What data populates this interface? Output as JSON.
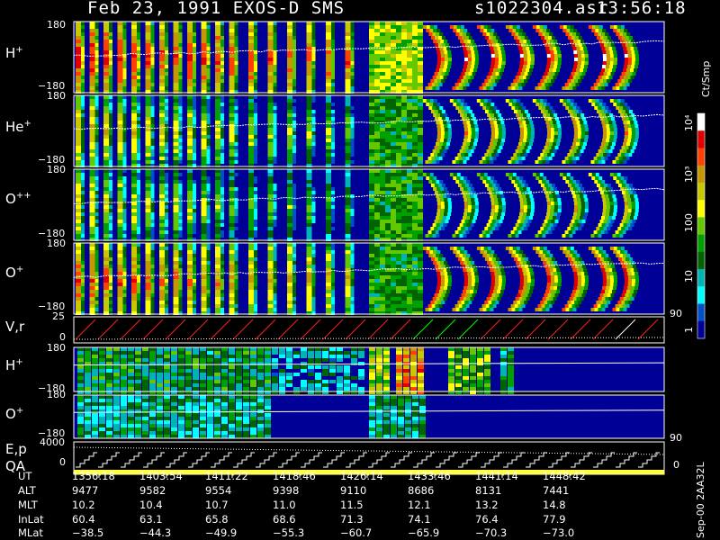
{
  "header": {
    "title": "Feb 23, 1991   EXOS-D SMS",
    "file": "s1022304.asr",
    "time": "13:56:18"
  },
  "panels": [
    {
      "label": "H+",
      "sup": "+",
      "base": "H",
      "top_tick": "180",
      "bottom_tick": "−180"
    },
    {
      "label": "He+",
      "sup": "+",
      "base": "He",
      "top_tick": "180",
      "bottom_tick": "−180"
    },
    {
      "label": "O++",
      "sup": "++",
      "base": "O",
      "top_tick": "180",
      "bottom_tick": "−180"
    },
    {
      "label": "O+",
      "sup": "+",
      "base": "O",
      "top_tick": "180",
      "bottom_tick": "−180"
    }
  ],
  "vr_panel": {
    "label": "V,r",
    "top_tick": "25",
    "bottom_tick": "0",
    "right_tick": "90"
  },
  "lower_panels": [
    {
      "label": "H+",
      "sup": "+",
      "base": "H",
      "top_tick": "180",
      "bottom_tick": "−180"
    },
    {
      "label": "O+",
      "sup": "+",
      "base": "O",
      "top_tick": "180",
      "bottom_tick": "−180",
      "right_tick": "90"
    }
  ],
  "ep_panel": {
    "label1": "E,p",
    "label2": "QA",
    "top_tick": "4000",
    "bottom_tick": "0",
    "right_tick": "0"
  },
  "colorbar": {
    "unit": "Ct/Smp",
    "ticks": [
      "10⁴",
      "10³",
      "100",
      "10",
      "1"
    ],
    "colors": [
      "#ffffff",
      "#e00000",
      "#ff4000",
      "#c89600",
      "#c8c800",
      "#ffff00",
      "#64c800",
      "#00a000",
      "#006400",
      "#00b4b4",
      "#00ffff",
      "#0050c8",
      "#000096"
    ]
  },
  "footer": {
    "rows": [
      {
        "label": "UT",
        "values": [
          "1356:18",
          "1403:54",
          "1411:22",
          "1418:46",
          "1426:14",
          "1433:46",
          "1441:14",
          "1448:42"
        ]
      },
      {
        "label": "ALT",
        "values": [
          "9477",
          "9582",
          "9554",
          "9398",
          "9110",
          "8686",
          "8131",
          "7441"
        ]
      },
      {
        "label": "MLT",
        "values": [
          "10.2",
          "10.4",
          "10.7",
          "11.0",
          "11.5",
          "12.1",
          "13.2",
          "14.8"
        ]
      },
      {
        "label": "InLat",
        "values": [
          "60.4",
          "63.1",
          "65.8",
          "68.6",
          "71.3",
          "74.1",
          "76.4",
          "77.9"
        ]
      },
      {
        "label": "MLat",
        "values": [
          "−38.5",
          "−44.3",
          "−49.9",
          "−55.3",
          "−60.7",
          "−65.9",
          "−70.3",
          "−73.0"
        ]
      }
    ],
    "side_label": "Sep-00  2AA32L"
  },
  "chart_data": {
    "type": "heatmap",
    "title": "Feb 23, 1991   EXOS-D SMS",
    "panels": [
      "H+",
      "He+",
      "O++",
      "O+",
      "V,r",
      "H+",
      "O+",
      "E,p / QA"
    ],
    "y_range_deg": [
      -180,
      180
    ],
    "vr_range": [
      0,
      25
    ],
    "ep_range": [
      0,
      4000
    ],
    "color_scale": {
      "unit": "Ct/Smp",
      "log": true,
      "range": [
        1,
        10000
      ]
    },
    "x_ticks_ut": [
      "1356:18",
      "1403:54",
      "1411:22",
      "1418:46",
      "1426:14",
      "1433:46",
      "1441:14",
      "1448:42"
    ]
  }
}
